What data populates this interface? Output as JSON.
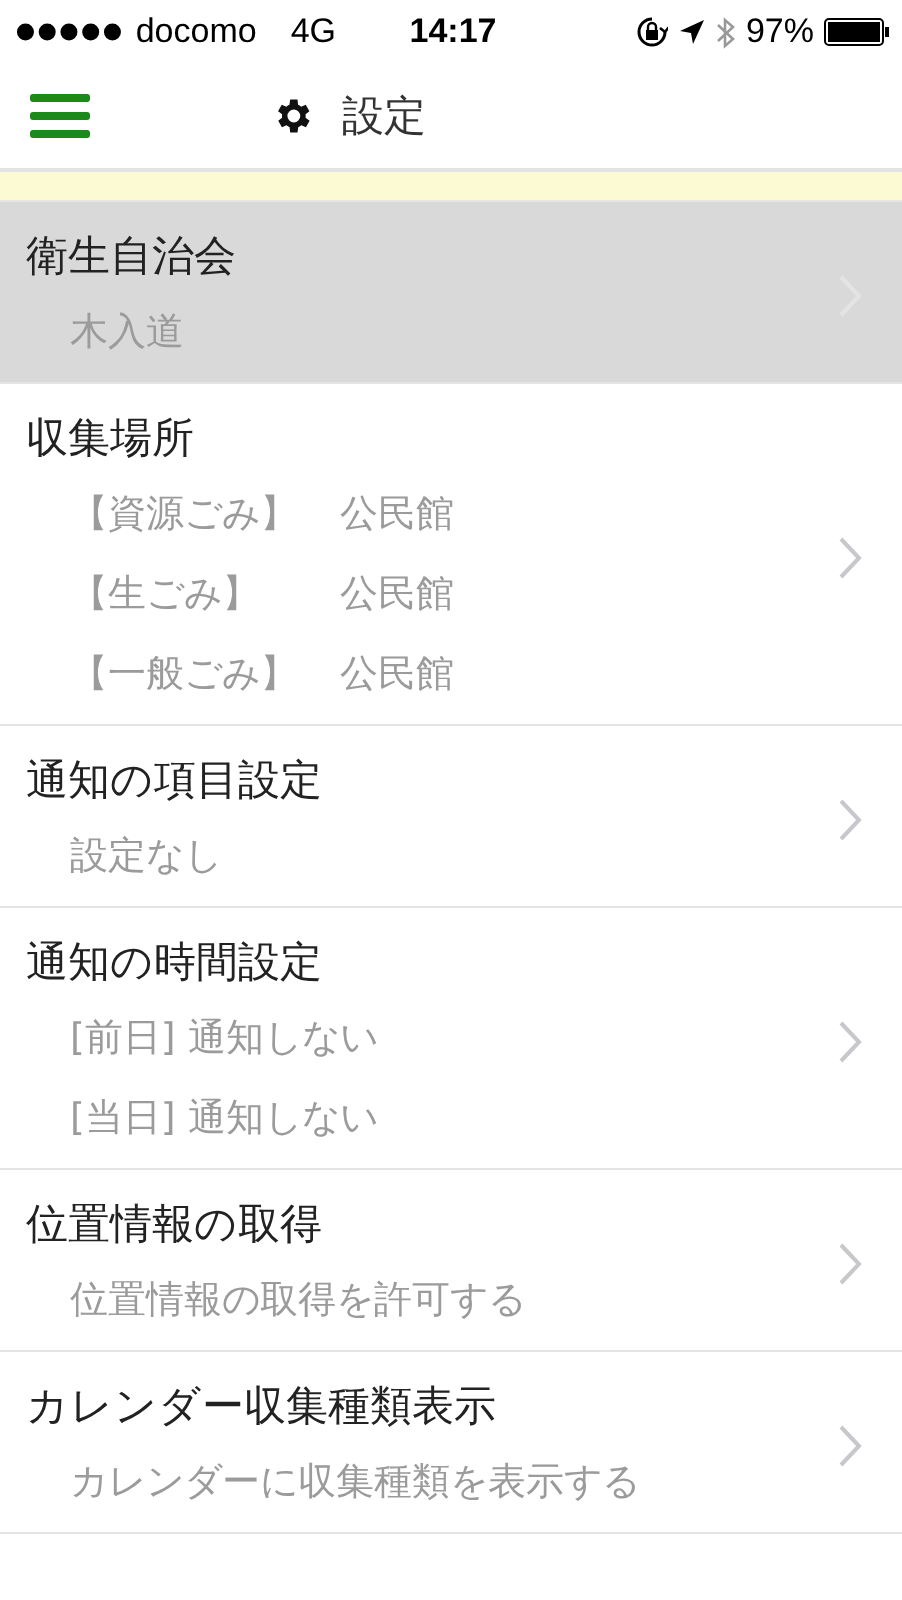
{
  "status_bar": {
    "carrier": "docomo",
    "network": "4G",
    "time": "14:17",
    "battery": "97%"
  },
  "header": {
    "title": "設定"
  },
  "items": [
    {
      "title": "衛生自治会",
      "selected": true,
      "lines": [
        {
          "kind": "plain",
          "text": "木入道"
        }
      ]
    },
    {
      "title": "収集場所",
      "selected": false,
      "lines": [
        {
          "kind": "pair",
          "tag": "【資源ごみ】",
          "text": "公民館"
        },
        {
          "kind": "pair",
          "tag": "【生ごみ】",
          "text": "公民館"
        },
        {
          "kind": "pair",
          "tag": "【一般ごみ】",
          "text": "公民館"
        }
      ]
    },
    {
      "title": "通知の項目設定",
      "selected": false,
      "lines": [
        {
          "kind": "plain",
          "text": "設定なし"
        }
      ]
    },
    {
      "title": "通知の時間設定",
      "selected": false,
      "lines": [
        {
          "kind": "plain",
          "text": "[前日] 通知しない"
        },
        {
          "kind": "plain",
          "text": "[当日] 通知しない"
        }
      ]
    },
    {
      "title": "位置情報の取得",
      "selected": false,
      "lines": [
        {
          "kind": "plain",
          "text": "位置情報の取得を許可する"
        }
      ]
    },
    {
      "title": "カレンダー収集種類表示",
      "selected": false,
      "lines": [
        {
          "kind": "plain",
          "text": "カレンダーに収集種類を表示する"
        }
      ]
    }
  ]
}
